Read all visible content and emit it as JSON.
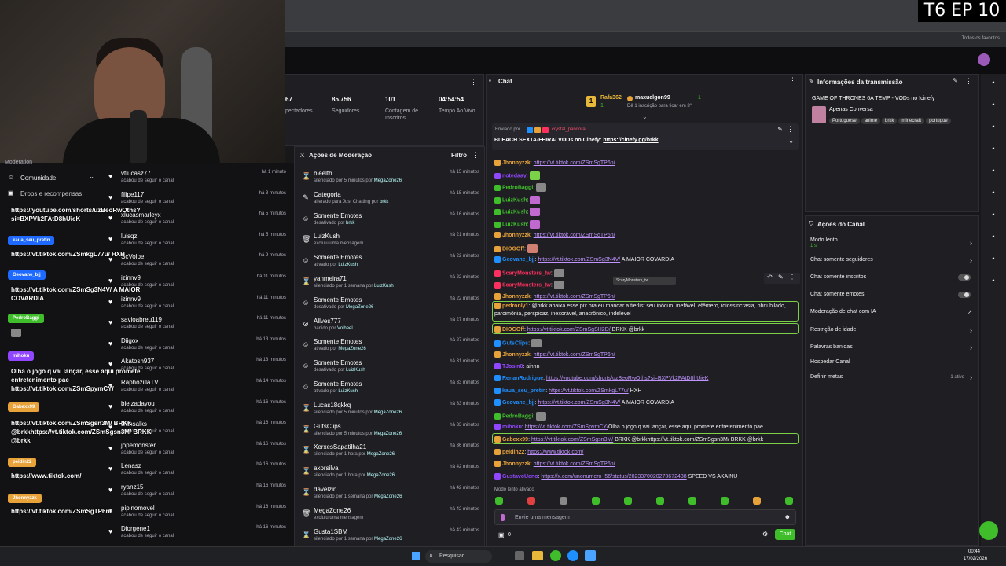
{
  "episode_badge": "T6 EP 10",
  "browser": {
    "favorites": "Todos os favoritos"
  },
  "stats": {
    "viewers": "67",
    "viewers_label": "pectadores",
    "followers": "85.756",
    "followers_label": "Seguidores",
    "subs": "101",
    "subs_label": "Contagem de Inscritos",
    "live_time": "04:54:54",
    "live_label": "Tempo Ao Vivo"
  },
  "left_menu": {
    "community": "Comunidade",
    "drops": "Drops e recompensas",
    "moderation": "Moderation"
  },
  "activity_feed": [
    {
      "name": "vtlucasz77",
      "sub": "acabou de seguir o canal",
      "time": "há 1 minuto"
    },
    {
      "name": "filipe117",
      "sub": "acabou de seguir o canal",
      "time": "há 3 minutos"
    },
    {
      "name": "xlucasmarleyx",
      "sub": "acabou de seguir o canal",
      "time": "há 5 minutos"
    },
    {
      "name": "luisqz",
      "sub": "acabou de seguir o canal",
      "time": "há 5 minutos"
    },
    {
      "name": "ScVolpe",
      "sub": "acabou de seguir o canal",
      "time": "há 9 minutos"
    },
    {
      "name": "izinnv9",
      "sub": "acabou de seguir o canal",
      "time": "há 11 minutos"
    },
    {
      "name": "izinnv9",
      "sub": "acabou de seguir o canal",
      "time": "há 11 minutos"
    },
    {
      "name": "savioabreu119",
      "sub": "acabou de seguir o canal",
      "time": "há 11 minutos"
    },
    {
      "name": "Diigox",
      "sub": "acabou de seguir o canal",
      "time": "há 13 minutos"
    },
    {
      "name": "Akatosh937",
      "sub": "acabou de seguir o canal",
      "time": "há 13 minutos"
    },
    {
      "name": "RaphozillaTV",
      "sub": "acabou de seguir o canal",
      "time": "há 14 minutos"
    },
    {
      "name": "bielzadayou",
      "sub": "acabou de seguir o canal",
      "time": "há 16 minutos"
    },
    {
      "name": "Dansalks",
      "sub": "acabou de seguir o canal",
      "time": "há 16 minutos"
    },
    {
      "name": "jopemonster",
      "sub": "acabou de seguir o canal",
      "time": "há 16 minutos"
    },
    {
      "name": "Lenasz",
      "sub": "acabou de seguir o canal",
      "time": "há 16 minutos"
    },
    {
      "name": "ryanz15",
      "sub": "acabou de seguir o canal",
      "time": "há 16 minutos"
    },
    {
      "name": "pipinomovel",
      "sub": "acabou de seguir o canal",
      "time": "há 16 minutos"
    },
    {
      "name": "Diorgene1",
      "sub": "acabou de seguir o canal",
      "time": "há 16 minutos"
    }
  ],
  "overlay_chat": [
    {
      "user": "",
      "color": "#1e69ff",
      "text": "https://youtube.com/shorts/uzBeoRwOths?si=BXPVk2FAtD8hUieK"
    },
    {
      "user": "kaua_seu_pretin",
      "color": "#1e69ff",
      "text": "https://vt.tiktok.com/ZSmkgL77u/ HXH"
    },
    {
      "user": "Geovane_bjj",
      "color": "#1e69ff",
      "text": "https://vt.tiktok.com/ZSmSg3N4V/ A MAIOR COVARDIA"
    },
    {
      "user": "PedroBaggi",
      "color": "#3fbd2b",
      "text": ""
    },
    {
      "user": "mihoku",
      "color": "#9147ff",
      "text": "Olha o jogo q vai lançar, esse aqui promete entretenimento pae https://vt.tiktok.com/ZSmSpymCY/"
    },
    {
      "user": "Gabexx99",
      "color": "#e8a23a",
      "text": "https://vt.tiktok.com/ZSmSgsn3M/ BRKK @brkkhttps://vt.tiktok.com/ZSmSgsn3M/ BRKK @brkk"
    },
    {
      "user": "peidin22",
      "color": "#e8a23a",
      "text": "https://www.tiktok.com/"
    },
    {
      "user": "Jhonnyzzk",
      "color": "#e8a23a",
      "text": "https://vt.tiktok.com/ZSmSgTP6n/"
    }
  ],
  "mod": {
    "title": "Ações de Moderação",
    "filter": "Filtro",
    "rows": [
      {
        "icon": "hourglass",
        "title": "bieelth",
        "sub": "silenciado por 5 minutos por ",
        "by": "MegaZone26",
        "time": "há 15 minutos"
      },
      {
        "icon": "pencil",
        "title": "Categoria",
        "sub": "alterado para Just Chatting por ",
        "by": "brkk",
        "time": "há 15 minutos"
      },
      {
        "icon": "smile",
        "title": "Somente Emotes",
        "sub": "desativado por ",
        "by": "brkk",
        "time": "há 16 minutos"
      },
      {
        "icon": "trash",
        "title": "LuizKush",
        "sub": "excluiu uma mensagem",
        "by": "",
        "time": "há 21 minutos"
      },
      {
        "icon": "smile",
        "title": "Somente Emotes",
        "sub": "ativado por ",
        "by": "LuizKush",
        "time": "há 22 minutos"
      },
      {
        "icon": "hourglass",
        "title": "yanmeira71",
        "sub": "silenciado por 1 semana por ",
        "by": "LuizKush",
        "time": "há 22 minutos"
      },
      {
        "icon": "smile",
        "title": "Somente Emotes",
        "sub": "desativado por ",
        "by": "MegaZone26",
        "time": "há 22 minutos"
      },
      {
        "icon": "ban",
        "title": "Allves777",
        "sub": "banido por ",
        "by": "Volbeel",
        "time": "há 27 minutos"
      },
      {
        "icon": "smile",
        "title": "Somente Emotes",
        "sub": "ativado por ",
        "by": "MegaZone26",
        "time": "há 27 minutos"
      },
      {
        "icon": "smile",
        "title": "Somente Emotes",
        "sub": "desativado por ",
        "by": "LuizKush",
        "time": "há 31 minutos"
      },
      {
        "icon": "smile",
        "title": "Somente Emotes",
        "sub": "ativado por ",
        "by": "LuizKush",
        "time": "há 33 minutos"
      },
      {
        "icon": "hourglass",
        "title": "Lucas18qkkq",
        "sub": "silenciado por 5 minutos por ",
        "by": "MegaZone26",
        "time": "há 33 minutos"
      },
      {
        "icon": "hourglass",
        "title": "GutsClips",
        "sub": "silenciado por 5 minutos por ",
        "by": "MegaZone26",
        "time": "há 33 minutos"
      },
      {
        "icon": "hourglass",
        "title": "XerxesSapatilha21",
        "sub": "silenciado por 1 hora por ",
        "by": "MegaZone26",
        "time": "há 36 minutos"
      },
      {
        "icon": "hourglass",
        "title": "axorsilva",
        "sub": "silenciado por 1 hora por ",
        "by": "MegaZone26",
        "time": "há 42 minutos"
      },
      {
        "icon": "hourglass",
        "title": "davelzin",
        "sub": "silenciado por 1 semana por ",
        "by": "MegaZone26",
        "time": "há 42 minutos"
      },
      {
        "icon": "trash",
        "title": "MegaZone26",
        "sub": "excluiu uma mensagem",
        "by": "",
        "time": "há 42 minutos"
      },
      {
        "icon": "hourglass",
        "title": "Gusta1SBM",
        "sub": "silenciado por 1 semana por ",
        "by": "MegaZone26",
        "time": "há 42 minutos"
      }
    ]
  },
  "chat": {
    "title": "Chat",
    "leader1": "Rafa362",
    "leader1_n": "1",
    "leader2": "maxuelgon99",
    "leader2_n": "1",
    "leader_sub": "Dê 1 inscrição para ficar em 3º",
    "pinned_by": "Enviado por",
    "pinned_user": "crystal_pandora",
    "pinned_text": "BLEACH SEXTA-FEIRA/ VODs no Cinefy: ",
    "pinned_link": "https://cinefy.gg/brkk",
    "tooltip": "ScaryMonsters_tw",
    "messages": [
      {
        "user": "Jhonnyzzk",
        "color": "#e8a23a",
        "text": "",
        "link": "https://vt.tiktok.com/ZSmSgTP6n/"
      },
      {
        "user": "notedaay",
        "color": "#9147ff",
        "text": "",
        "link": "",
        "emote": "#7bd148"
      },
      {
        "user": "PedroBaggi",
        "color": "#3fbd2b",
        "text": "",
        "link": "",
        "emote": "#888"
      },
      {
        "user": "LuizKush",
        "color": "#3fbd2b",
        "text": "",
        "link": "",
        "emote": "#c06ad0"
      },
      {
        "user": "LuizKush",
        "color": "#3fbd2b",
        "text": "",
        "link": "",
        "emote": "#c06ad0"
      },
      {
        "user": "LuizKush",
        "color": "#3fbd2b",
        "text": "",
        "link": "",
        "emote": "#c06ad0"
      },
      {
        "user": "Jhonnyzzk",
        "color": "#e8a23a",
        "text": "",
        "link": "https://vt.tiktok.com/ZSmSgTP6n/"
      },
      {
        "user": "DIOGOff",
        "color": "#e8a23a",
        "text": "",
        "link": "",
        "emote": "#d08070"
      },
      {
        "user": "Geovane_bjj",
        "color": "#1e90ff",
        "text": " A MAIOR COVARDIA",
        "link": "https://vt.tiktok.com/ZSmSg3N4V/"
      },
      {
        "user": "ScaryMonsters_tw",
        "color": "#ff3060",
        "text": "",
        "link": "",
        "emote": "#888"
      },
      {
        "user": "ScaryMonsters_tw",
        "color": "#ff3060",
        "text": "",
        "link": "",
        "emote": "#888"
      },
      {
        "user": "Jhonnyzzk",
        "color": "#e8a23a",
        "text": "",
        "link": "https://vt.tiktok.com/ZSmSgTP6n/"
      },
      {
        "user": "pedronly1",
        "color": "#e8a23a",
        "text": "@brkk abaixa esse pix pra eu mandar a tierlist seu inócuo, inefável, efêmero, idiossincrasia, obnubilado, parcimônia, perspicaz, inexorável, anacrônico, indelével",
        "link": "",
        "hl": true
      },
      {
        "user": "DIOGOff",
        "color": "#e8a23a",
        "text": " BRKK @brkk",
        "link": "https://vt.tiktok.com/ZSmSgSH2D/",
        "hl": true
      },
      {
        "user": "GutsClips",
        "color": "#1e90ff",
        "text": "",
        "link": "",
        "emote": "#888"
      },
      {
        "user": "Jhonnyzzk",
        "color": "#e8a23a",
        "text": "",
        "link": "https://vt.tiktok.com/ZSmSgTP6n/"
      },
      {
        "user": "TJosin0",
        "color": "#9147ff",
        "text": "ainnn",
        "link": ""
      },
      {
        "user": "RenanRodrigue",
        "color": "#1e90ff",
        "text": "",
        "link": "https://youtube.com/shorts/uzBeoRwOths?si=BXPVk2FAtD8hUieK"
      },
      {
        "user": "kaua_seu_pretin",
        "color": "#1e90ff",
        "text": " HXH",
        "link": "https://vt.tiktok.com/ZSmkgL77u/"
      },
      {
        "user": "Geovane_bjj",
        "color": "#1e90ff",
        "text": " A MAIOR COVARDIA",
        "link": "https://vt.tiktok.com/ZSmSg3N4V/"
      },
      {
        "user": "PedroBaggi",
        "color": "#3fbd2b",
        "text": "",
        "link": "",
        "emote": "#888"
      },
      {
        "user": "mihoku",
        "color": "#9147ff",
        "text": "Olha o jogo q vai lançar, esse aqui promete entretenimento pae ",
        "link": "https://vt.tiktok.com/ZSmSpymCY/"
      },
      {
        "user": "Gabexx99",
        "color": "#e8a23a",
        "text": " BRKK @brkkhttps://vt.tiktok.com/ZSmSgsn3M/ BRKK @brkk",
        "link": "https://vt.tiktok.com/ZSmSgsn3M/",
        "hl": true
      },
      {
        "user": "peidin22",
        "color": "#e8a23a",
        "text": "",
        "link": "https://www.tiktok.com/"
      },
      {
        "user": "Jhonnyzzk",
        "color": "#e8a23a",
        "text": "",
        "link": "https://vt.tiktok.com/ZSmSgTP6n/"
      },
      {
        "user": "GustavoUeno",
        "color": "#9147ff",
        "text": " SPEED VS AKAINU",
        "link": "https://x.com/unonumero_56/status/2023370020273672438"
      }
    ],
    "slow_mode": "Modo lento ativado",
    "input_placeholder": "Envie uma mensagem",
    "points": "0",
    "send": "Chat"
  },
  "info": {
    "title": "Informações da transmissão",
    "stream_title": "GAME OF THRONES 6A TEMP - VODs no !cinefy",
    "category": "Apenas Conversa",
    "tags": [
      "Portuguese",
      "anime",
      "brkk",
      "minecraft",
      "portugue"
    ]
  },
  "actions": {
    "title": "Ações do Canal",
    "slow": "Modo lento",
    "slow_val": "1 s",
    "items": [
      "Chat somente seguidores",
      "Chat somente inscritos",
      "Chat somente emotes",
      "Moderação de chat com IA",
      "Restrição de idade",
      "Palavras banidas",
      "Hospedar Canal",
      "Definir metas"
    ],
    "goals_active": "1 ativo"
  },
  "taskbar": {
    "search": "Pesquisar",
    "time": "00:44",
    "date": "17/02/2026"
  }
}
